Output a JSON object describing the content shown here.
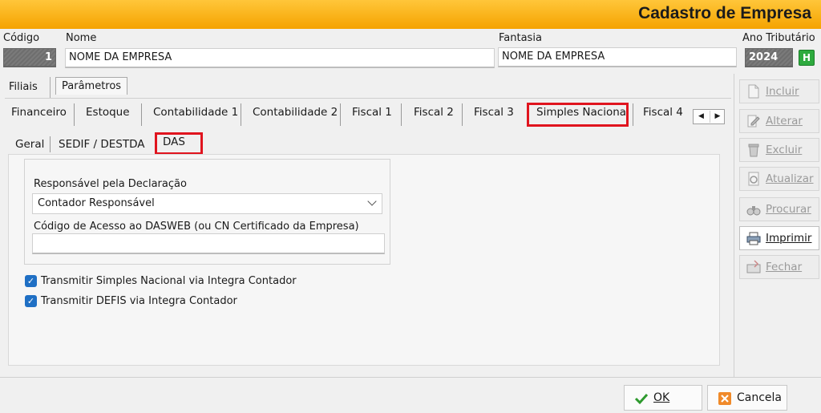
{
  "window": {
    "title": "Cadastro de Empresa"
  },
  "header": {
    "codigo_label": "Código",
    "codigo_value": "1",
    "nome_label": "Nome",
    "nome_value": "NOME DA EMPRESA",
    "fantasia_label": "Fantasia",
    "fantasia_value": "NOME DA EMPRESA",
    "ano_label": "Ano Tributário",
    "ano_value": "2024",
    "h_button": "H"
  },
  "outer_tabs": [
    "Filiais",
    "Parâmetros"
  ],
  "param_tabs": [
    "Financeiro",
    "Estoque",
    "Contabilidade 1",
    "Contabilidade 2",
    "Fiscal 1",
    "Fiscal 2",
    "Fiscal 3",
    "Simples Nacional",
    "Fiscal 4"
  ],
  "sub_tabs": [
    "Geral",
    "SEDIF / DESTDA",
    "DAS"
  ],
  "form": {
    "responsavel_label": "Responsável pela Declaração",
    "responsavel_value": "Contador Responsável",
    "codigo_acesso_label": "Código de Acesso ao DASWEB (ou CN Certificado da Empresa)",
    "codigo_acesso_value": "",
    "check1_label": "Transmitir Simples Nacional via Integra Contador",
    "check2_label": "Transmitir DEFIS via Integra Contador"
  },
  "sidebar": [
    "Incluir",
    "Alterar",
    "Excluir",
    "Atualizar",
    "Procurar",
    "Imprimir",
    "Fechar"
  ],
  "dialog": {
    "ok": "OK",
    "cancel": "Cancela"
  },
  "colors": {
    "title_bar": "#f5a300",
    "highlight": "#e0141e",
    "checkbox": "#1f6fc4"
  }
}
